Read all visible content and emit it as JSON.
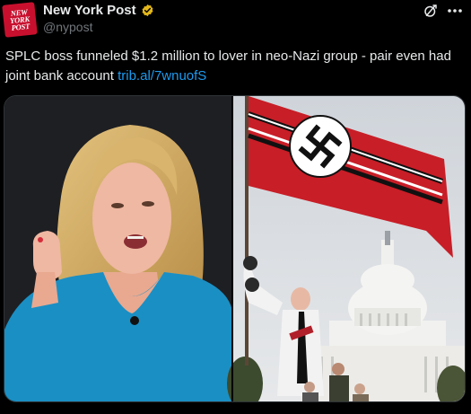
{
  "account": {
    "display_name": "New York Post",
    "handle": "@nypost",
    "avatar_text": [
      "NEW",
      "YORK",
      "POST"
    ],
    "brand_color": "#c8102e",
    "verified_color": "#e2b719"
  },
  "post": {
    "text": "SPLC boss funneled $1.2 million to lover in neo-Nazi group - pair even had joint bank account",
    "link_text": "trib.al/7wnuofS",
    "link_color": "#1d9bf0"
  },
  "icons": {
    "grok": "grok-icon",
    "more": "more-icon",
    "verified": "verified-badge-icon"
  },
  "media": {
    "left_image": "woman-speaking-photo",
    "right_image": "flag-at-capitol-photo"
  }
}
